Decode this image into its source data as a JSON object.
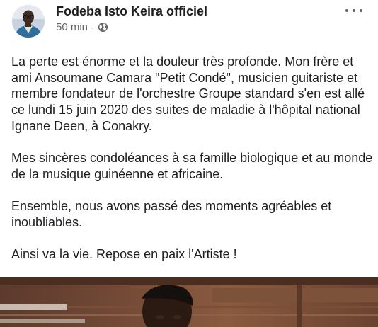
{
  "post": {
    "author": "Fodeba Isto Keira officiel",
    "time": "50 min",
    "separator": "·",
    "privacy_icon": "globe-icon",
    "more_icon": "more-options-icon",
    "paragraphs": [
      "La perte est énorme et la douleur très profonde. Mon frère et ami Ansoumane Camara \"Petit Condé\", musicien guitariste et membre fondateur de l'orchestre Groupe standard s'en est allé ce lundi 15 juin 2020 des suites de maladie à l'hôpital national Ignane Deen, à Conakry.",
      "Mes sincères condoléances à sa famille biologique et au monde de la musique guinéenne et africaine.",
      "Ensemble, nous avons passé des moments agréables et inoubliables.",
      "Ainsi va la vie. Repose en paix l'Artiste !"
    ]
  },
  "colors": {
    "text": "#1c1e21",
    "secondary": "#65676b"
  }
}
